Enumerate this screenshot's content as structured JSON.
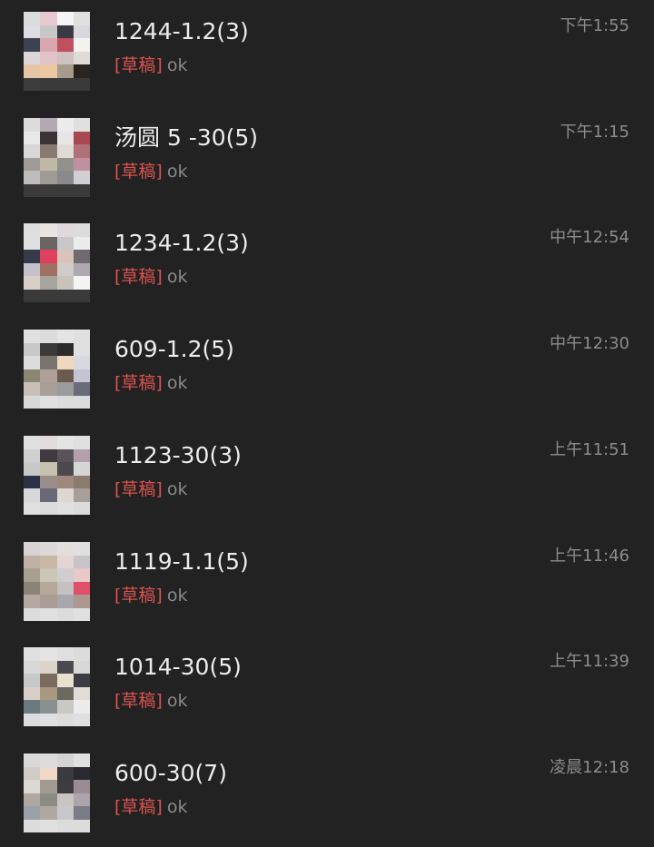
{
  "draft_label": "[草稿]",
  "chats": [
    {
      "title": "1244-1.2(3)",
      "preview": "ok",
      "time": "下午1:55",
      "avatar_colors": [
        "#dcdcdc",
        "#e8c8d0",
        "#f4f4f4",
        "#e0e0e0",
        "#dddde3",
        "#c7c7c7",
        "#3a3a44",
        "#d9d9dd",
        "#3c4252",
        "#d8a8b0",
        "#c05060",
        "#f2f2ee",
        "#dcd6d6",
        "#e2c3c9",
        "#cfc2c0",
        "#dfdcd8",
        "#e7c3a8",
        "#ecc8a0",
        "#a89a8c",
        "#2a2420",
        "#3c3c3c",
        "#3a3a3a",
        "#3a3a3a",
        "#3a3a3a"
      ]
    },
    {
      "title": "汤圆 5 -30(5)",
      "preview": "ok",
      "time": "下午1:15",
      "avatar_colors": [
        "#dcdcdc",
        "#b6aab2",
        "#ececec",
        "#e0e0e0",
        "#e8e8e8",
        "#3c3434",
        "#e6e6e6",
        "#a84850",
        "#d8d8d8",
        "#887a72",
        "#e0dad6",
        "#b07078",
        "#a09a98",
        "#c2b8a8",
        "#92908a",
        "#c090a0",
        "#bcbcbc",
        "#9e9a96",
        "#8a8a8e",
        "#d0d0d4",
        "#3a3a3a",
        "#3a3a3a",
        "#3a3a3a",
        "#3a3a3a"
      ]
    },
    {
      "title": "1234-1.2(3)",
      "preview": "ok",
      "time": "中午12:54",
      "avatar_colors": [
        "#dedede",
        "#e8e4e4",
        "#e0d8dc",
        "#dcdcdc",
        "#e0e0e0",
        "#6a6462",
        "#c8c8c8",
        "#ececec",
        "#343a48",
        "#e04060",
        "#d8c4b8",
        "#6e6a70",
        "#c6c2cc",
        "#a07060",
        "#d0ccc8",
        "#b0a8b0",
        "#d8d0c8",
        "#a8a49e",
        "#c8c4bc",
        "#f4f4f2",
        "#3a3a3a",
        "#3a3a3a",
        "#3a3a3a",
        "#3a3a3a"
      ]
    },
    {
      "title": "609-1.2(5)",
      "preview": "ok",
      "time": "中午12:30",
      "avatar_colors": [
        "#e0e0e0",
        "#dcdcdc",
        "#e4e4e4",
        "#e0e0e0",
        "#c8c8c8",
        "#3a3a3a",
        "#2c2c2c",
        "#e0e0e0",
        "#dcdcdc",
        "#7a7470",
        "#f0d8c0",
        "#d8d8e0",
        "#8a8674",
        "#b0a098",
        "#6a5a50",
        "#c4c4d4",
        "#c8c0b8",
        "#a8a098",
        "#9a9c9c",
        "#6a6c7a",
        "#d8d8d8",
        "#e0e0e0",
        "#dcdcdc",
        "#dcdcdc"
      ]
    },
    {
      "title": "1123-30(3)",
      "preview": "ok",
      "time": "上午11:51",
      "avatar_colors": [
        "#e0e0e0",
        "#e0dcdc",
        "#e4e4e4",
        "#e0e0e0",
        "#d0d0d0",
        "#3e3a40",
        "#5a545a",
        "#b4a0a8",
        "#c8c8c8",
        "#c6c0b0",
        "#4c4a4e",
        "#d6d6d6",
        "#2a3046",
        "#9a8c88",
        "#a0887c",
        "#8a7a70",
        "#d8d8dc",
        "#6a6a76",
        "#dcd8d0",
        "#a8a098",
        "#e0e0e0",
        "#dcdcdc",
        "#e0e0e0",
        "#dcdcdc"
      ]
    },
    {
      "title": "1119-1.1(5)",
      "preview": "ok",
      "time": "上午11:46",
      "avatar_colors": [
        "#d8d4d4",
        "#dcdad8",
        "#e2dede",
        "#e0e0e0",
        "#c0b0a8",
        "#c8b8a4",
        "#e4d4d4",
        "#c8c4c8",
        "#a8a090",
        "#cac6b8",
        "#d0ccd0",
        "#e8c8c8",
        "#8a8478",
        "#b6a898",
        "#c4c0c4",
        "#e05068",
        "#b4a8a0",
        "#a89c94",
        "#aaa6ae",
        "#ac9890",
        "#dcdcdc",
        "#e0e0e0",
        "#dcdcdc",
        "#e0e0e0"
      ]
    },
    {
      "title": "1014-30(5)",
      "preview": "ok",
      "time": "上午11:39",
      "avatar_colors": [
        "#e0e0e0",
        "#e4e4e4",
        "#e0e0e0",
        "#dcdcdc",
        "#d8d8d8",
        "#dcd4c8",
        "#4a4a50",
        "#d8d8d8",
        "#c8c8c8",
        "#7a6a60",
        "#e8e0d0",
        "#3c3c44",
        "#d8d0c8",
        "#a89880",
        "#6a6a60",
        "#e0dcd8",
        "#6a7a80",
        "#8a9090",
        "#c8c8c4",
        "#ececec",
        "#dcdcdc",
        "#e0e0e0",
        "#dcdcdc",
        "#e0e0e0"
      ]
    },
    {
      "title": "600-30(7)",
      "preview": "ok",
      "time": "凌晨12:18",
      "avatar_colors": [
        "#d8d8d8",
        "#dcdcdc",
        "#d4d4d4",
        "#e0e0e0",
        "#d0ccc8",
        "#f0d8c8",
        "#3a3a40",
        "#2a2830",
        "#dcd8d4",
        "#a09a90",
        "#3e3c40",
        "#9a8c90",
        "#b0a8a0",
        "#8a8c84",
        "#c8c4c0",
        "#aca4ac",
        "#9aa0a8",
        "#b0a8a0",
        "#c8c8cc",
        "#7a7c88",
        "#dcdcdc",
        "#e0e0e0",
        "#dcdcdc",
        "#dcdcdc"
      ]
    }
  ]
}
